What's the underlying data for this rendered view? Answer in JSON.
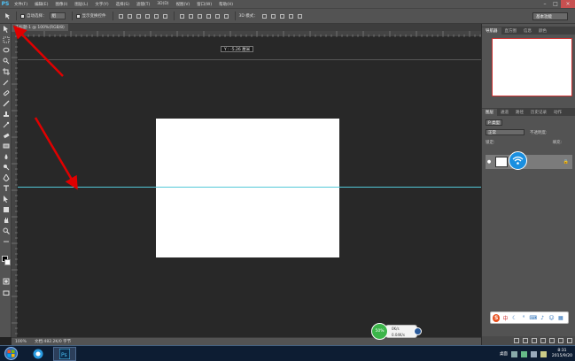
{
  "app": {
    "logo_text": "PS"
  },
  "menu": [
    "文件(F)",
    "编辑(E)",
    "图像(I)",
    "图层(L)",
    "文字(Y)",
    "选择(S)",
    "滤镜(T)",
    "3D(D)",
    "视图(V)",
    "窗口(W)",
    "帮助(H)"
  ],
  "options_bar": {
    "auto_select_label": "自动选择：",
    "auto_select_value": "组",
    "show_transform_label": "显示变换控件",
    "mode_3d_label": "3D 模式：",
    "workspace": "基本功能"
  },
  "document": {
    "tab_title": "未标题-1 @ 100%(RGB/8)",
    "tooltip": "Y : -5.26 厘米",
    "zoom": "100%",
    "doc_info": "文档:482.2K/0 字节"
  },
  "panels": {
    "nav_tabs": [
      "导航器",
      "直方图",
      "信息",
      "颜色"
    ],
    "layer_tabs": [
      "图层",
      "通道",
      "路径",
      "历史记录",
      "动作"
    ],
    "kind_label": "P 类型",
    "blend_mode": "正常",
    "opacity_label": "不透明度:",
    "lock_label": "锁定:",
    "fill_label": "填充:"
  },
  "network_widget": {
    "percent": "50%",
    "up": "0K/s",
    "down": "0.04K/s"
  },
  "ime": {
    "label": "中"
  },
  "taskbar": {
    "desktop_label": "桌面",
    "time": "8:31",
    "date": "2015/9/20"
  },
  "colors": {
    "guide": "#53c8d8",
    "panel_bg": "#535353",
    "canvas_bg": "#282828",
    "annotation_arrow": "#e00000"
  }
}
